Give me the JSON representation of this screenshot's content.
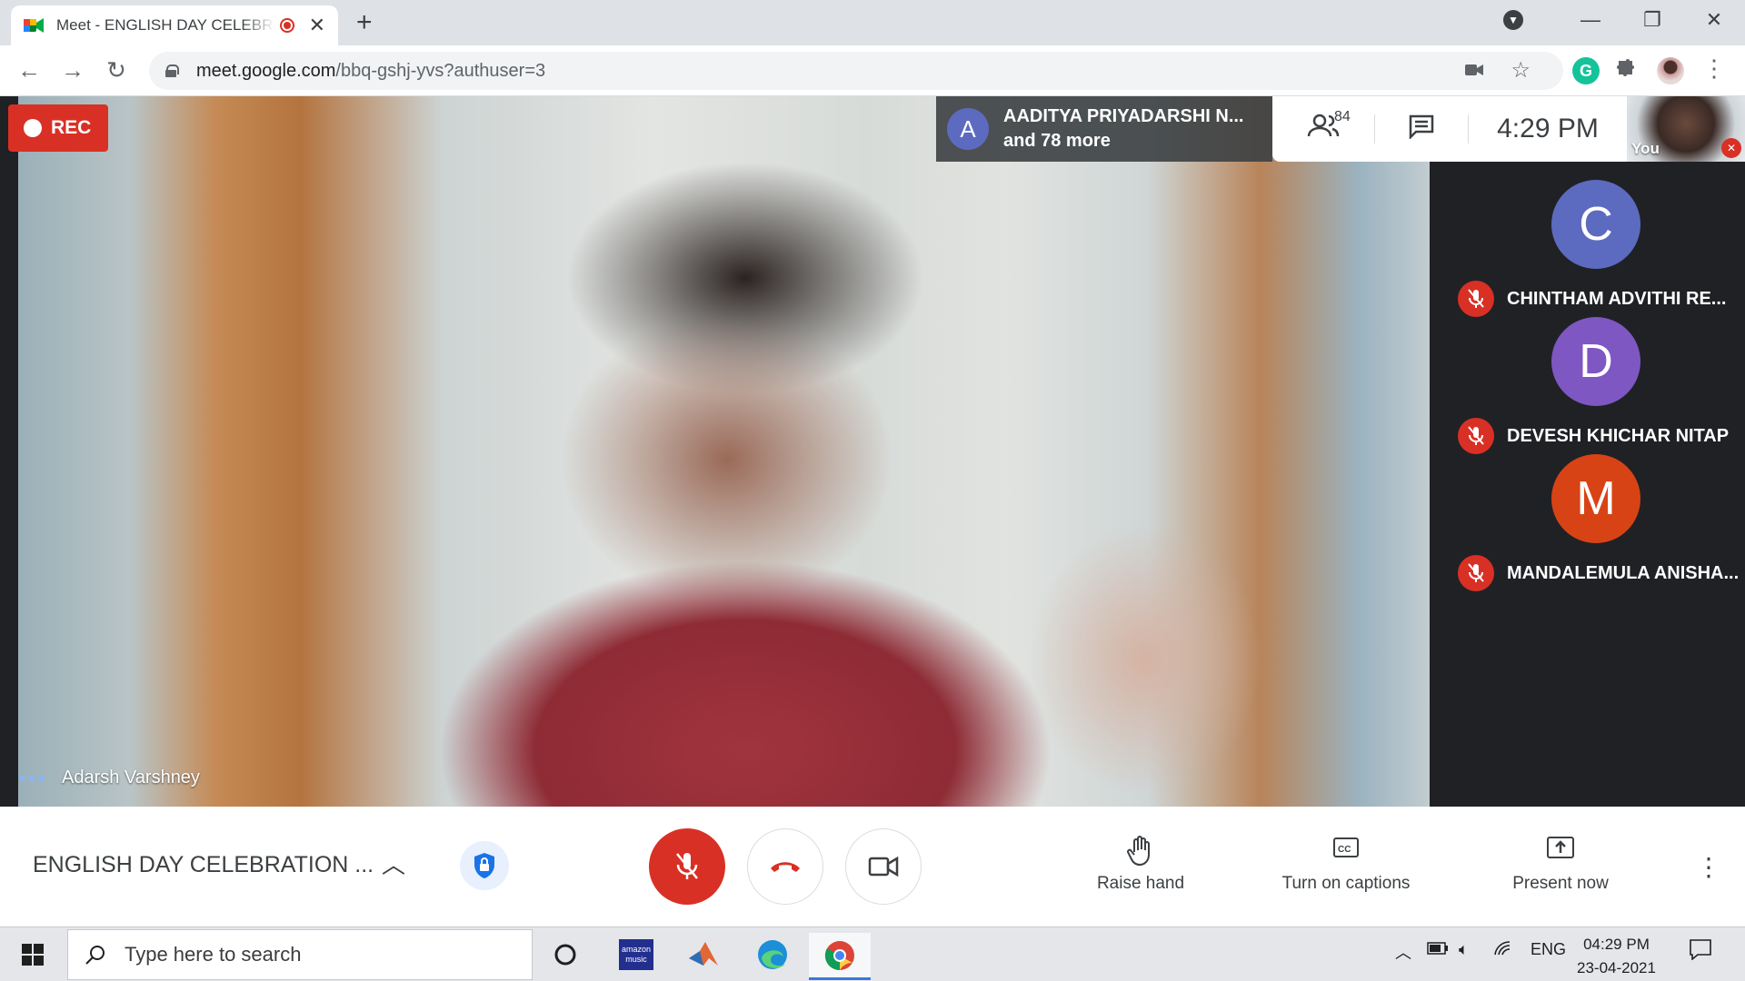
{
  "browser": {
    "tab_title": "Meet - ENGLISH DAY CELEBRATION",
    "url_host": "meet.google.com",
    "url_path": "/bbq-gshj-yvs?authuser=3"
  },
  "meet": {
    "rec_label": "REC",
    "speaker_name": "Adarsh Varshney",
    "presenting_avatar": "A",
    "presenting_name": "AADITYA PRIYADARSHI N...",
    "presenting_more": "and 78 more",
    "participant_count": "84",
    "time": "4:29  PM",
    "self_label": "You",
    "participants": [
      {
        "initial": "C",
        "name": "CHINTHAM ADVITHI RE...",
        "color": "#5c6bc0"
      },
      {
        "initial": "D",
        "name": "DEVESH KHICHAR NITAP",
        "color": "#7e57c2"
      },
      {
        "initial": "M",
        "name": "MANDALEMULA ANISHA...",
        "color": "#d84315"
      }
    ],
    "meeting_title": "ENGLISH DAY CELEBRATION ...",
    "raise_hand": "Raise hand",
    "captions": "Turn on captions",
    "present": "Present now"
  },
  "taskbar": {
    "search_placeholder": "Type here to search",
    "language": "ENG",
    "clock_time": "04:29 PM",
    "clock_date": "23-04-2021"
  },
  "colors": {
    "danger": "#d93025",
    "accent": "#1a73e8"
  }
}
